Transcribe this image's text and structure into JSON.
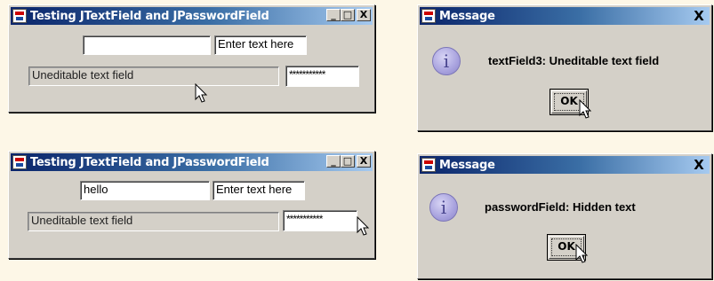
{
  "windows": [
    {
      "title": "Testing JTextField and JPasswordField",
      "minimize_glyph": "_",
      "maximize_glyph": "□",
      "close_glyph": "X",
      "text_field_1": "",
      "text_field_2": "Enter text here",
      "text_field_3": "Uneditable text field",
      "password_field": "***********"
    },
    {
      "title": "Testing JTextField and JPasswordField",
      "minimize_glyph": "_",
      "maximize_glyph": "□",
      "close_glyph": "X",
      "text_field_1": "hello",
      "text_field_2": "Enter text here",
      "text_field_3": "Uneditable text field",
      "password_field": "***********"
    }
  ],
  "dialogs": [
    {
      "title": "Message",
      "close_glyph": "X",
      "icon": "information-icon",
      "icon_glyph": "i",
      "message": "textField3: Uneditable text field",
      "ok_label": "OK"
    },
    {
      "title": "Message",
      "close_glyph": "X",
      "icon": "information-icon",
      "icon_glyph": "i",
      "message": "passwordField: Hidden text",
      "ok_label": "OK"
    }
  ],
  "colors": {
    "page_background": "#fdf7e7",
    "window_face": "#d4d0c8",
    "titlebar_start": "#0a246a",
    "titlebar_end": "#a6caf0",
    "info_icon": "#a8a2de"
  }
}
